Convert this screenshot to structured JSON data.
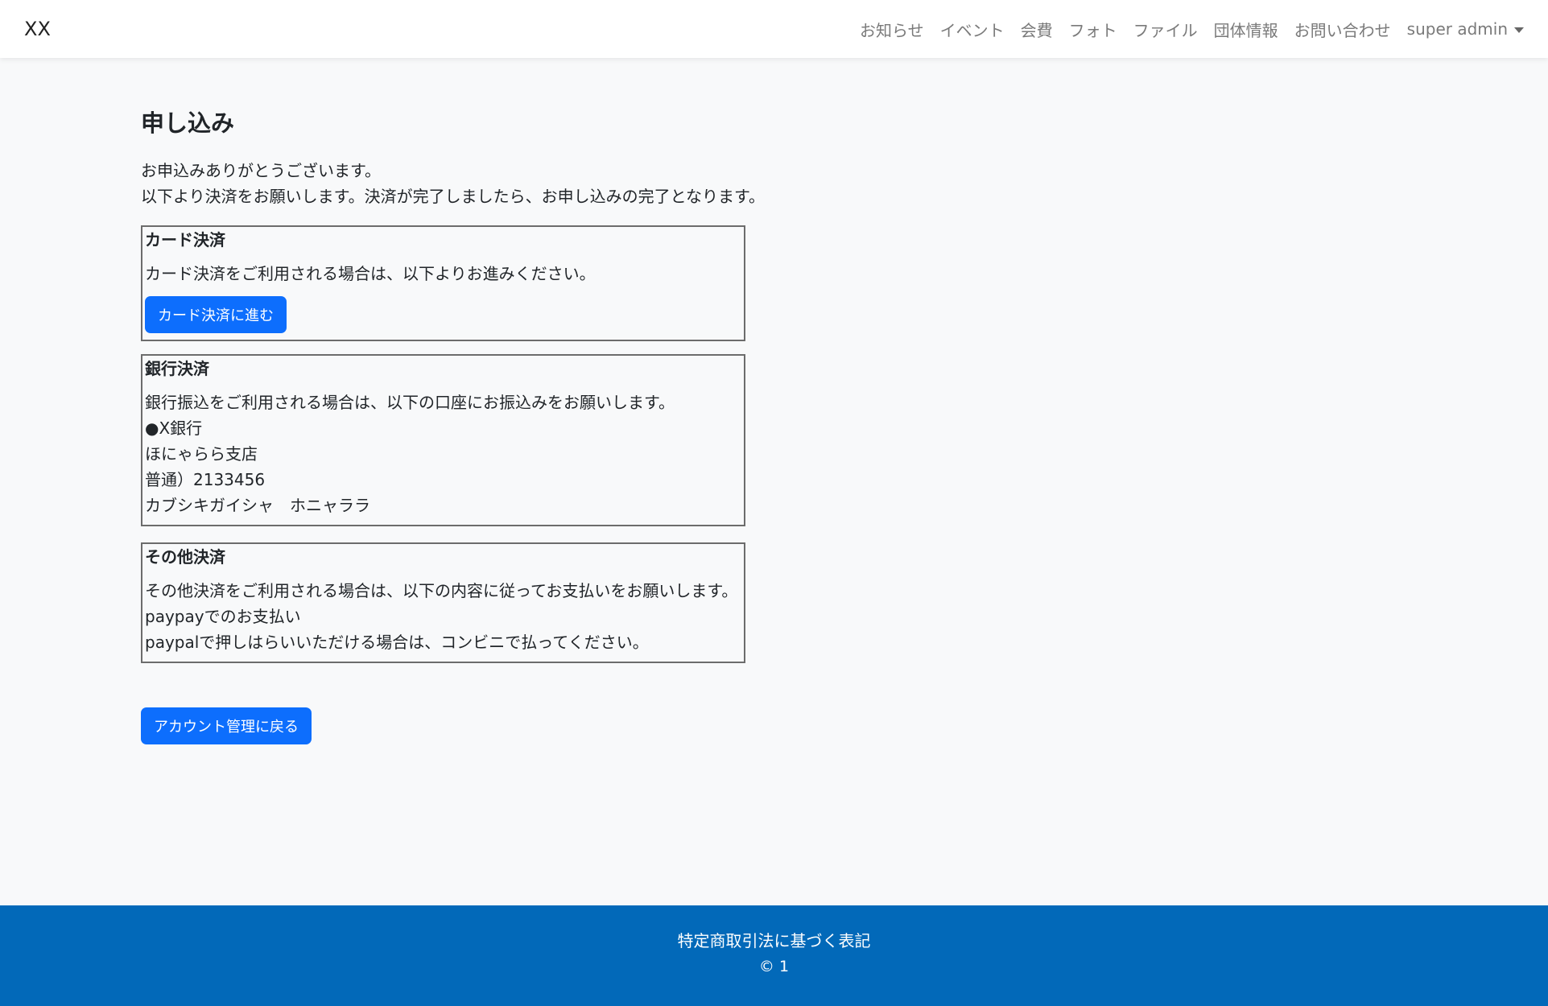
{
  "navbar": {
    "brand": "XX",
    "links": [
      "お知らせ",
      "イベント",
      "会費",
      "フォト",
      "ファイル",
      "団体情報",
      "お問い合わせ"
    ],
    "user": "super admin"
  },
  "page": {
    "title": "申し込み",
    "intro": [
      "お申込みありがとうございます。",
      "以下より決済をお願いします。決済が完了しましたら、お申し込みの完了となります。"
    ]
  },
  "card_payment": {
    "heading": "カード決済",
    "description": "カード決済をご利用される場合は、以下よりお進みください。",
    "button": "カード決済に進む"
  },
  "bank_payment": {
    "heading": "銀行決済",
    "lines": [
      "銀行振込をご利用される場合は、以下の口座にお振込みをお願いします。",
      "●X銀行",
      "ほにゃらら支店",
      "普通）2133456",
      "カブシキガイシャ　ホニャララ"
    ]
  },
  "other_payment": {
    "heading": "その他決済",
    "lines": [
      "その他決済をご利用される場合は、以下の内容に従ってお支払いをお願いします。",
      "paypayでのお支払い",
      "paypalで押しはらいいただける場合は、コンビニで払ってください。"
    ]
  },
  "back_button": "アカウント管理に戻る",
  "footer": {
    "link": "特定商取引法に基づく表記",
    "copyright": "© 1"
  },
  "colors": {
    "primary": "#0d6efd",
    "footer_bg": "#0269b9",
    "page_bg": "#f8f9fa"
  }
}
